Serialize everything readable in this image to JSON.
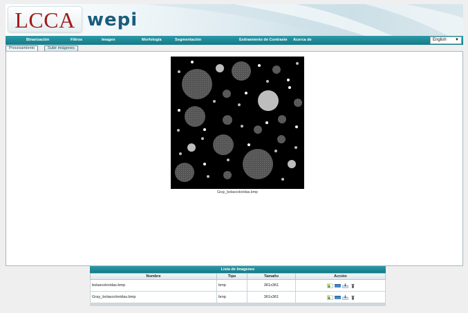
{
  "logo": {
    "lcca": "LCCA",
    "wepi": "wepi"
  },
  "menu": [
    "Binarización",
    "Filtros",
    "Imagen",
    "Morfología",
    "Segmentación",
    "Estiramiento de Contraste",
    "Acerca de"
  ],
  "language": "English",
  "tabs": [
    "Procesamiento",
    "Subir imágenes"
  ],
  "image_caption": "Gray_bolascoloridas.bmp",
  "table": {
    "title": "Lista de Imagenes",
    "headers": [
      "Nombre",
      "Tipo",
      "Tamaño",
      "Acción"
    ],
    "rows": [
      [
        "bolascoloridas.bmp",
        "bmp",
        "361x361"
      ],
      [
        "Gray_bolascoloridas.bmp",
        "bmp",
        "361x361"
      ]
    ]
  },
  "icons": [
    "open-icon",
    "view-icon",
    "download-icon",
    "trash-icon"
  ],
  "colors": {
    "menu_bar": "#1d8b98",
    "logo_red": "#a01c1c",
    "logo_blue": "#1a5c7d"
  }
}
